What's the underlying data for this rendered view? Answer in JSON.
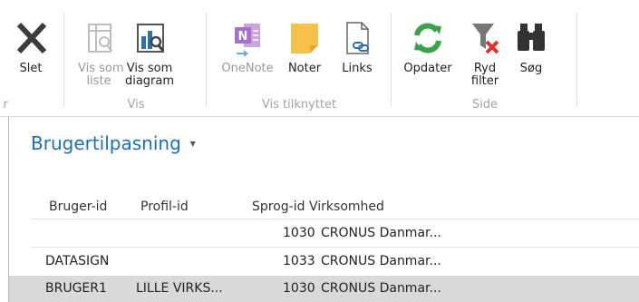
{
  "ribbon": {
    "buttons": {
      "slet": "Slet",
      "vis_som_liste_1": "Vis som",
      "vis_som_liste_2": "liste",
      "vis_som_diagram_1": "Vis som",
      "vis_som_diagram_2": "diagram",
      "onenote": "OneNote",
      "noter": "Noter",
      "links": "Links",
      "opdater": "Opdater",
      "ryd_filter_1": "Ryd",
      "ryd_filter_2": "filter",
      "soeg": "Søg"
    },
    "groups": {
      "cut": "r",
      "vis": "Vis",
      "vis_tilknyttet": "Vis tilknyttet",
      "side": "Side"
    },
    "colors": {
      "delete": "#3c3c3c",
      "onenote": "#8c3fb3",
      "note": "#f5c14b",
      "refresh": "#3aa348",
      "filter_x": "#e0302f"
    }
  },
  "page": {
    "title": "Brugertilpasning",
    "title_chevron": "▾"
  },
  "table": {
    "columns": {
      "bruger_id": "Bruger-id",
      "profil_id": "Profil-id",
      "sprog_id": "Sprog-id",
      "virksomhed": "Virksomhed"
    },
    "rows": [
      {
        "bruger_id": "",
        "profil_id": "",
        "sprog_id": "1030",
        "virksomhed": "CRONUS Danmar..."
      },
      {
        "bruger_id": "DATASIGN",
        "profil_id": "",
        "sprog_id": "1033",
        "virksomhed": "CRONUS Danmar..."
      },
      {
        "bruger_id": "BRUGER1",
        "profil_id": "LILLE VIRKS...",
        "sprog_id": "1030",
        "virksomhed": "CRONUS Danmar..."
      }
    ]
  }
}
